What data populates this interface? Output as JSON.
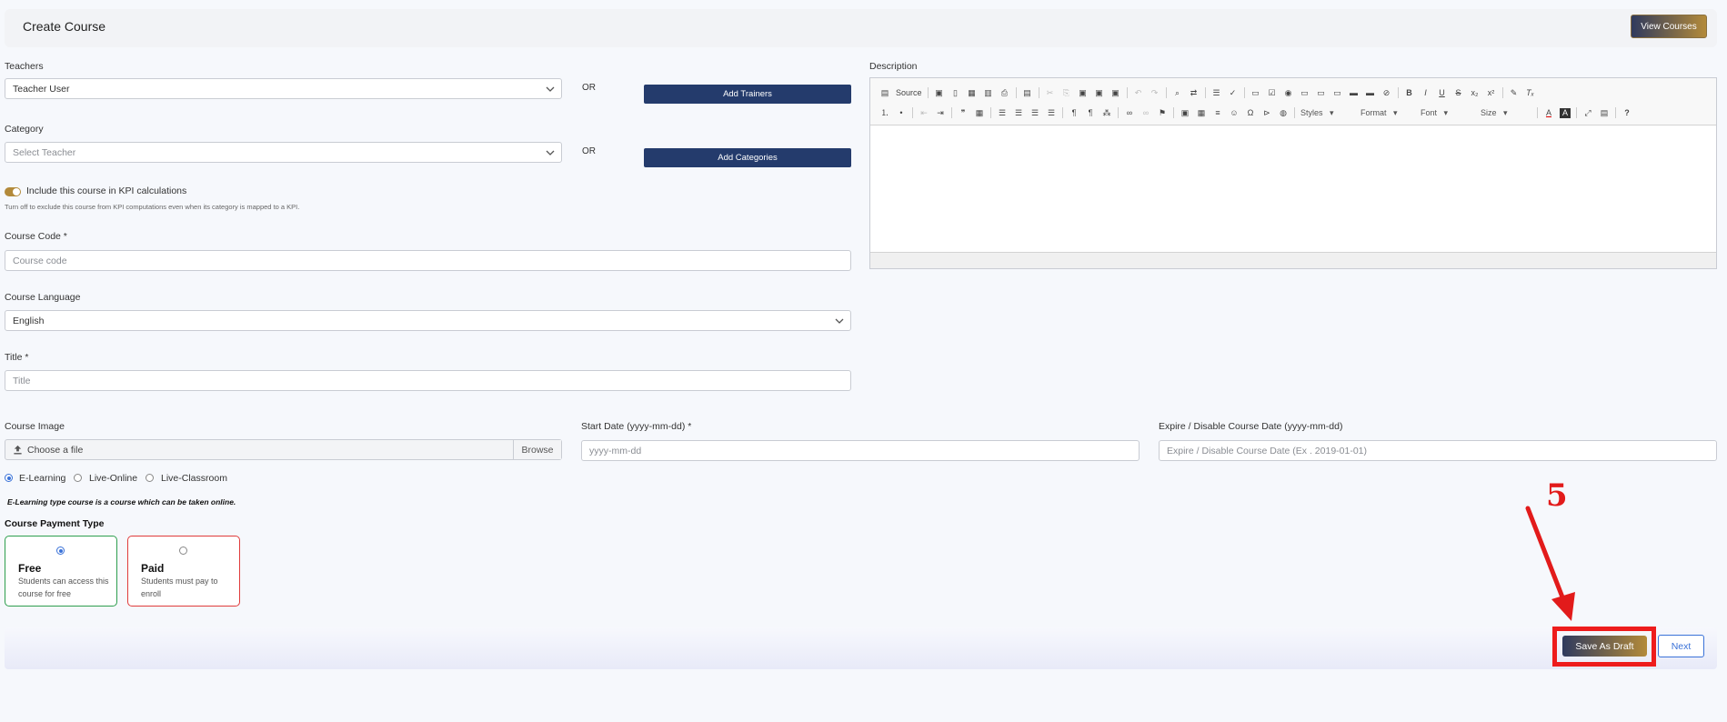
{
  "header": {
    "title": "Create Course",
    "view_courses": "View Courses"
  },
  "teachers": {
    "label": "Teachers",
    "value": "Teacher User",
    "or": "OR",
    "add_button": "Add Trainers"
  },
  "category": {
    "label": "Category",
    "placeholder": "Select Teacher",
    "or": "OR",
    "add_button": "Add Categories"
  },
  "kpi": {
    "enabled": true,
    "label": "Include this course in KPI calculations",
    "help": "Turn off to exclude this course from KPI computations even when its category is mapped to a KPI."
  },
  "course_code": {
    "label": "Course Code *",
    "placeholder": "Course code"
  },
  "course_language": {
    "label": "Course Language",
    "value": "English"
  },
  "title_field": {
    "label": "Title *",
    "placeholder": "Title"
  },
  "description": {
    "label": "Description",
    "toolbar_row1": [
      "Source",
      "Save",
      "New",
      "Templates",
      "Preview",
      "Print",
      "Paste",
      "Cut",
      "Copy",
      "Paste",
      "Paste Text",
      "Paste Word",
      "Undo",
      "Redo",
      "Find",
      "Replace",
      "Select All",
      "Spell Check",
      "Form",
      "Checkbox",
      "Radio",
      "Text Field",
      "Textarea",
      "Select",
      "Button",
      "Image Button",
      "Hidden Field",
      "Bold",
      "Italic",
      "Underline",
      "Strike",
      "Subscript",
      "Superscript",
      "Copy Formatting",
      "Remove Format"
    ],
    "toolbar_row2": [
      "Numbered List",
      "Bulleted List",
      "Outdent",
      "Indent",
      "Blockquote",
      "Div",
      "Align Left",
      "Center",
      "Align Right",
      "Justify",
      "LTR",
      "RTL",
      "Language",
      "Link",
      "Unlink",
      "Anchor",
      "Image",
      "Table",
      "Horizontal Line",
      "Smiley",
      "Special Char",
      "Page Break",
      "Iframe",
      "Styles",
      "Format",
      "Font",
      "Size",
      "Text Color",
      "Background Color",
      "Maximize",
      "Show Blocks",
      "Help"
    ],
    "styles": "Styles",
    "format": "Format",
    "font": "Font",
    "size": "Size"
  },
  "course_image": {
    "label": "Course Image",
    "placeholder": "Choose a file",
    "browse": "Browse"
  },
  "start_date": {
    "label": "Start Date (yyyy-mm-dd) *",
    "placeholder": "yyyy-mm-dd"
  },
  "expire_date": {
    "label": "Expire / Disable Course Date (yyyy-mm-dd)",
    "placeholder": "Expire / Disable Course Date (Ex . 2019-01-01)"
  },
  "course_type": {
    "options": [
      "E-Learning",
      "Live-Online",
      "Live-Classroom"
    ],
    "selected": "E-Learning",
    "note": "E-Learning type course is a course which can be taken online."
  },
  "payment": {
    "label": "Course Payment Type",
    "free": {
      "title": "Free",
      "desc": "Students can access this course for free"
    },
    "paid": {
      "title": "Paid",
      "desc": "Students must pay to enroll"
    },
    "selected": "Free"
  },
  "footer": {
    "save_draft": "Save As Draft",
    "next": "Next"
  },
  "annotation": {
    "step": "5"
  },
  "colors": {
    "accent_blue": "#243b6c",
    "gold": "#b38a3a",
    "highlight_red": "#ee1c1c",
    "free_border": "#2e9e4e",
    "paid_border": "#e03b3b"
  }
}
